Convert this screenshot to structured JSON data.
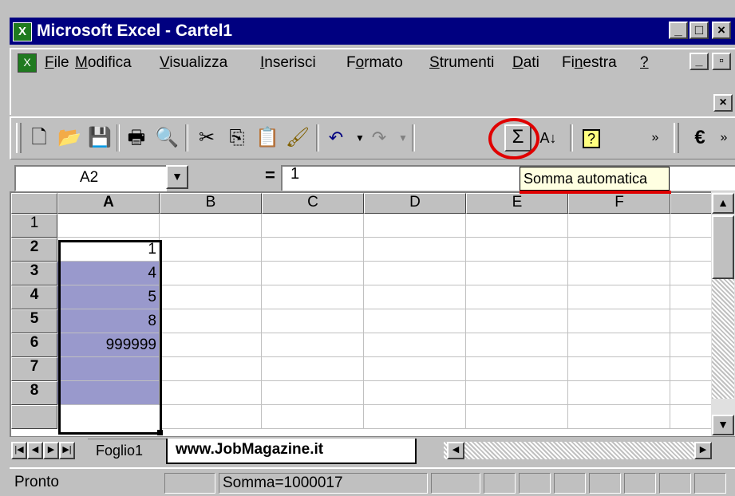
{
  "window": {
    "title": "Microsoft Excel - Cartel1"
  },
  "menu": {
    "items": [
      {
        "underline": "F",
        "rest": "ile"
      },
      {
        "underline": "M",
        "rest": "odifica"
      },
      {
        "underline": "V",
        "rest": "isualizza"
      },
      {
        "underline": "I",
        "rest": "nserisci"
      },
      {
        "pre": "F",
        "underline": "o",
        "rest": "rmato"
      },
      {
        "underline": "S",
        "rest": "trumenti"
      },
      {
        "underline": "D",
        "rest": "ati"
      },
      {
        "pre": "Fi",
        "underline": "n",
        "rest": "estra"
      },
      {
        "underline": "?",
        "rest": ""
      }
    ]
  },
  "toolbar": {
    "sum_symbol": "Σ",
    "euro_symbol": "€",
    "help_symbol": "?",
    "tooltip": "Somma automatica"
  },
  "formula_bar": {
    "name_box": "A2",
    "equals": "=",
    "value": "1"
  },
  "grid": {
    "columns": [
      "A",
      "B",
      "C",
      "D",
      "E",
      "F"
    ],
    "rows": [
      {
        "num": "1",
        "a": ""
      },
      {
        "num": "2",
        "a": "1"
      },
      {
        "num": "3",
        "a": "4"
      },
      {
        "num": "4",
        "a": "5"
      },
      {
        "num": "5",
        "a": "8"
      },
      {
        "num": "6",
        "a": "999999"
      },
      {
        "num": "7",
        "a": ""
      },
      {
        "num": "8",
        "a": ""
      }
    ]
  },
  "sheets": [
    "Foglio1",
    "www.JobMagazine.it"
  ],
  "status": {
    "mode": "Pronto",
    "sum": "Somma=1000017"
  },
  "colors": {
    "highlight": "#9999cc",
    "annotation": "#e00000",
    "titlebar": "#000080"
  }
}
